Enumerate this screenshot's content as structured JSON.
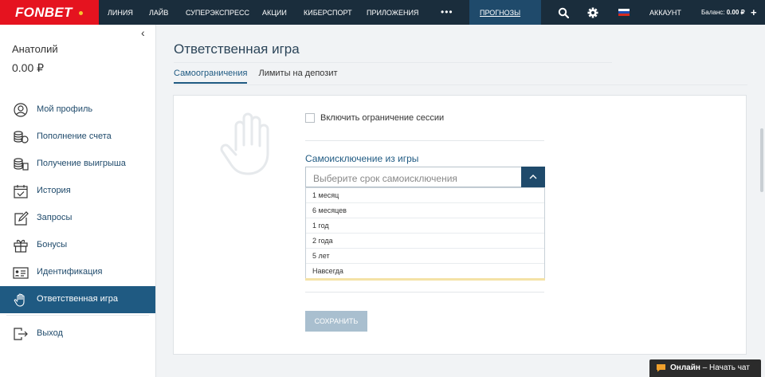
{
  "topbar": {
    "logo": "FONBET",
    "nav": [
      "ЛИНИЯ",
      "ЛАЙВ",
      "СУПЕРЭКСПРЕСС",
      "АКЦИИ",
      "КИБЕРСПОРТ",
      "ПРИЛОЖЕНИЯ"
    ],
    "more": "•••",
    "prognoz": "ПРОГНОЗЫ",
    "account": "АККАУНТ",
    "balance_label": "Баланс:",
    "balance_value": "0.00 ₽",
    "plus": "+",
    "colors": {
      "bar": "#1a2d3c",
      "logo_bg": "#e5131f",
      "accent": "#1f4a6b"
    }
  },
  "sidebar": {
    "collapse": "‹",
    "user_name": "Анатолий",
    "user_balance": "0.00 ₽",
    "items": [
      {
        "label": "Мой профиль",
        "icon": "user-icon"
      },
      {
        "label": "Пополнение счета",
        "icon": "coins-icon"
      },
      {
        "label": "Получение выигрыша",
        "icon": "withdraw-icon"
      },
      {
        "label": "История",
        "icon": "calendar-check-icon"
      },
      {
        "label": "Запросы",
        "icon": "edit-icon"
      },
      {
        "label": "Бонусы",
        "icon": "gift-icon"
      },
      {
        "label": "Идентификация",
        "icon": "id-card-icon"
      },
      {
        "label": "Ответственная игра",
        "icon": "hand-icon",
        "active": true
      }
    ],
    "logout": {
      "label": "Выход",
      "icon": "logout-icon"
    }
  },
  "main": {
    "title": "Ответственная игра",
    "tabs": [
      {
        "label": "Самоограничения",
        "active": true
      },
      {
        "label": "Лимиты на депозит",
        "active": false
      }
    ],
    "session_checkbox_label": "Включить ограничение сессии",
    "exclusion_label": "Самоисключение из игры",
    "select_placeholder": "Выберите срок самоисключения",
    "options": [
      "1 месяц",
      "6 месяцев",
      "1 год",
      "2 года",
      "5 лет",
      "Навсегда"
    ],
    "save_label": "СОХРАНИТЬ"
  },
  "chat": {
    "status": "Онлайн",
    "label": " – Начать чат"
  }
}
